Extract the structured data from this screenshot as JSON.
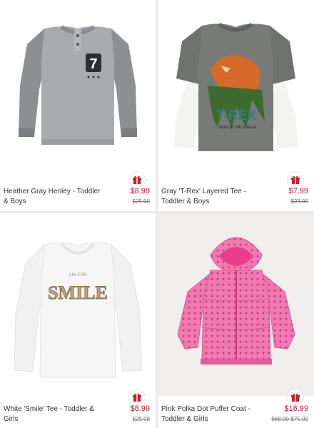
{
  "products": [
    {
      "name": "Heather Gray Henley - Toddler & Boys",
      "price": "$8.99",
      "was": "$25.00"
    },
    {
      "name": "Gray 'T-Rex' Layered Tee - Toddler & Boys",
      "price": "$7.99",
      "was": "$23.00",
      "graphic_text": "T-REX",
      "graphic_subtext": "KING OF THE JUNGLE"
    },
    {
      "name": "White 'Smile' Tee - Toddler & Girls",
      "price": "$8.99",
      "was": "$25.00",
      "graphic_text": "SMILE",
      "graphic_subtext": "AIM FOR"
    },
    {
      "name": "Pink Polka Dot Puffer Coat - Toddler & Girls",
      "price": "$16.99",
      "was": "$68.00-$75.00"
    }
  ],
  "colors": {
    "sale_price": "#c8202f",
    "gift_icon": "#c8202f",
    "page_bg": "#e9e9e9"
  },
  "icons": {
    "gift": "gift-icon"
  }
}
